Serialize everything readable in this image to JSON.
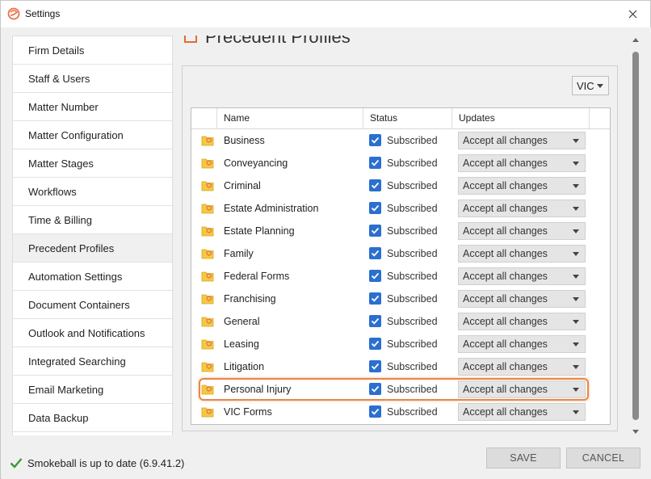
{
  "window": {
    "title": "Settings"
  },
  "sidebar": {
    "items": [
      {
        "label": "Firm Details"
      },
      {
        "label": "Staff & Users"
      },
      {
        "label": "Matter Number"
      },
      {
        "label": "Matter Configuration"
      },
      {
        "label": "Matter Stages"
      },
      {
        "label": "Workflows"
      },
      {
        "label": "Time & Billing"
      },
      {
        "label": "Precedent Profiles",
        "active": true
      },
      {
        "label": "Automation Settings"
      },
      {
        "label": "Document Containers"
      },
      {
        "label": "Outlook and Notifications"
      },
      {
        "label": "Integrated Searching"
      },
      {
        "label": "Email Marketing"
      },
      {
        "label": "Data Backup"
      }
    ]
  },
  "main": {
    "heading": "Precedent Profiles",
    "region": {
      "value": "VIC"
    },
    "columns": {
      "name": "Name",
      "status": "Status",
      "updates": "Updates"
    },
    "rows": [
      {
        "name": "Business",
        "status": "Subscribed",
        "checked": true,
        "updates": "Accept all changes"
      },
      {
        "name": "Conveyancing",
        "status": "Subscribed",
        "checked": true,
        "updates": "Accept all changes"
      },
      {
        "name": "Criminal",
        "status": "Subscribed",
        "checked": true,
        "updates": "Accept all changes"
      },
      {
        "name": "Estate Administration",
        "status": "Subscribed",
        "checked": true,
        "updates": "Accept all changes"
      },
      {
        "name": "Estate Planning",
        "status": "Subscribed",
        "checked": true,
        "updates": "Accept all changes"
      },
      {
        "name": "Family",
        "status": "Subscribed",
        "checked": true,
        "updates": "Accept all changes"
      },
      {
        "name": "Federal Forms",
        "status": "Subscribed",
        "checked": true,
        "updates": "Accept all changes"
      },
      {
        "name": "Franchising",
        "status": "Subscribed",
        "checked": true,
        "updates": "Accept all changes"
      },
      {
        "name": "General",
        "status": "Subscribed",
        "checked": true,
        "updates": "Accept all changes"
      },
      {
        "name": "Leasing",
        "status": "Subscribed",
        "checked": true,
        "updates": "Accept all changes"
      },
      {
        "name": "Litigation",
        "status": "Subscribed",
        "checked": true,
        "updates": "Accept all changes"
      },
      {
        "name": "Personal Injury",
        "status": "Subscribed",
        "checked": true,
        "updates": "Accept all changes",
        "highlighted": true
      },
      {
        "name": "VIC Forms",
        "status": "Subscribed",
        "checked": true,
        "updates": "Accept all changes"
      }
    ]
  },
  "footer": {
    "status_text": "Smokeball is up to date (6.9.41.2)",
    "save_label": "SAVE",
    "cancel_label": "CANCEL"
  },
  "colors": {
    "accent_orange": "#e8864a",
    "checkbox_blue": "#2a6fd1",
    "status_green": "#3a9a3a",
    "folder_yellow": "#f5c842"
  },
  "icons": {
    "app": "smokeball-logo-icon",
    "close": "close-icon",
    "folder": "folder-precedent-icon",
    "checkbox": "checkbox-checked-icon",
    "status": "checkmark-icon"
  }
}
